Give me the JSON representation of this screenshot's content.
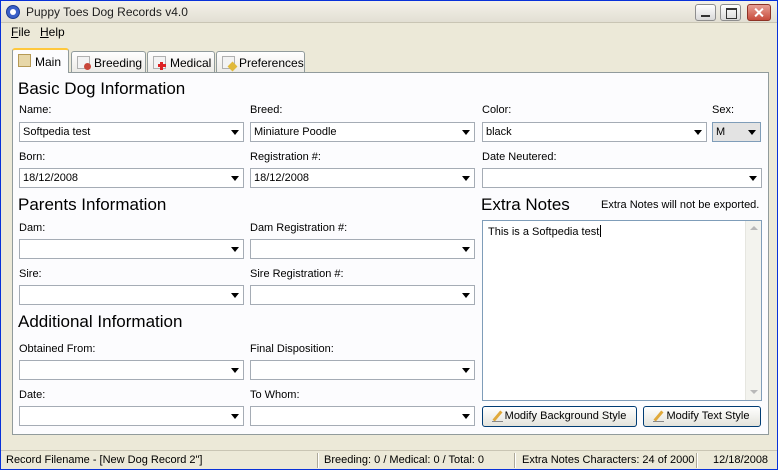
{
  "window": {
    "title": "Puppy Toes Dog Records v4.0"
  },
  "menu": {
    "file": "File",
    "help": "Help"
  },
  "tabs": [
    {
      "label": "Main",
      "icon": "document-icon"
    },
    {
      "label": "Breeding",
      "icon": "breeding-icon"
    },
    {
      "label": "Medical",
      "icon": "medical-icon"
    },
    {
      "label": "Preferences",
      "icon": "preferences-icon"
    }
  ],
  "basic": {
    "title": "Basic Dog Information",
    "name_label": "Name:",
    "name_value": "Softpedia test",
    "breed_label": "Breed:",
    "breed_value": "Miniature Poodle",
    "color_label": "Color:",
    "color_value": "black",
    "sex_label": "Sex:",
    "sex_value": "M",
    "born_label": "Born:",
    "born_value": "18/12/2008",
    "reg_label": "Registration #:",
    "reg_value": "18/12/2008",
    "neutered_label": "Date Neutered:",
    "neutered_value": ""
  },
  "parents": {
    "title": "Parents Information",
    "dam_label": "Dam:",
    "dam_value": "",
    "dam_reg_label": "Dam Registration #:",
    "dam_reg_value": "",
    "sire_label": "Sire:",
    "sire_value": "",
    "sire_reg_label": "Sire Registration #:",
    "sire_reg_value": ""
  },
  "additional": {
    "title": "Additional Information",
    "obtained_label": "Obtained From:",
    "obtained_value": "",
    "disposition_label": "Final Disposition:",
    "disposition_value": "",
    "date_label": "Date:",
    "date_value": "",
    "whom_label": "To Whom:",
    "whom_value": ""
  },
  "notes": {
    "title": "Extra Notes",
    "hint": "Extra Notes will not be exported.",
    "text": "This is a Softpedia test",
    "bg_button": "Modify Background Style",
    "text_button": "Modify Text Style"
  },
  "status": {
    "filename": "Record Filename - [New Dog Record 2\"]",
    "counts": "Breeding: 0 / Medical: 0 / Total: 0",
    "chars": "Extra Notes Characters: 24 of 2000",
    "date": "12/18/2008"
  }
}
